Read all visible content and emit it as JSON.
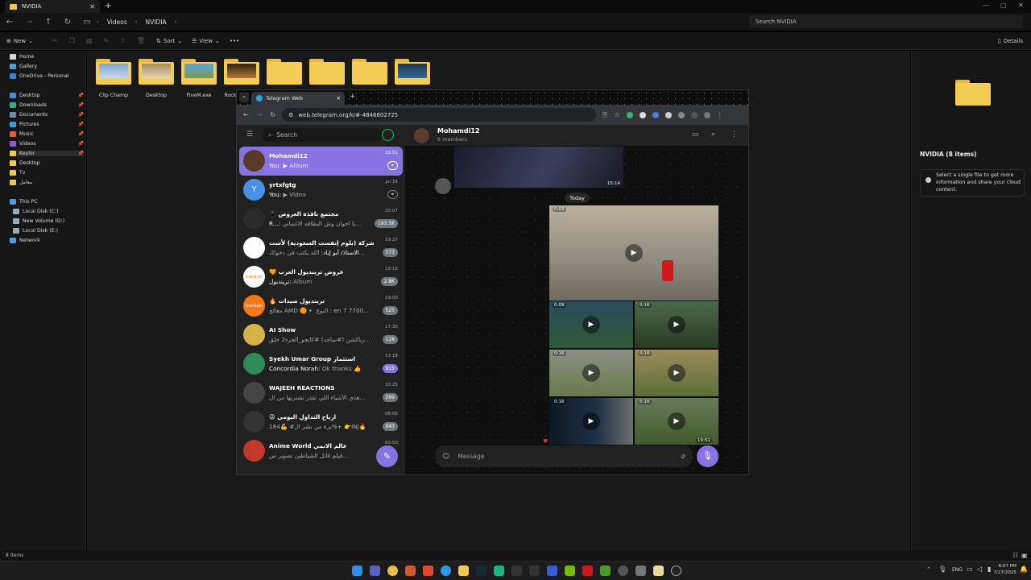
{
  "explorer": {
    "tab_title": "NVIDIA",
    "breadcrumb": [
      "Videos",
      "NVIDIA"
    ],
    "search_placeholder": "Search NVIDIA",
    "toolbar": {
      "new": "New",
      "sort": "Sort",
      "view": "View",
      "more": "•••",
      "details": "Details"
    },
    "sidebar": {
      "quick": [
        "Home",
        "Gallery",
        "OneDrive - Personal"
      ],
      "pinned": [
        "Desktop",
        "Downloads",
        "Documents",
        "Pictures",
        "Music",
        "Videos",
        "Keylor",
        "Desktop",
        "Tv",
        "معامل"
      ],
      "this_pc": "This PC",
      "drives": [
        "Local Disk (C:)",
        "New Volume (D:)",
        "Local Disk (E:)"
      ],
      "network": "Network"
    },
    "folders": [
      "Clip Champ",
      "Desktop",
      "FiveM.exe",
      "Rock"
    ],
    "details_pane": {
      "title": "NVIDIA (8 items)",
      "info": "Select a single file to get more information and share your cloud content."
    },
    "status": "8 items"
  },
  "browser": {
    "tab_title": "Telegram Web",
    "url": "web.telegram.org/k/#-4846602725"
  },
  "telegram": {
    "search_placeholder": "Search",
    "chats": [
      {
        "title": "Mohamdi12",
        "sender": "You:",
        "preview": "▶ Album",
        "time": "19:51",
        "badge": "",
        "avatar_text": "",
        "avatar_color": "#5a3a2a"
      },
      {
        "title": "yrtxfgtg",
        "sender": "You:",
        "preview": "▶ Video",
        "time": "Jul 16",
        "badge": "",
        "avatar_text": "Y",
        "avatar_color": "#4a90e2"
      },
      {
        "title": "📱 مجتمع نافذة العروض",
        "sender": "R...:",
        "preview": "يا احوان وش البطاقه الائتماني...",
        "time": "20:07",
        "badge": "193.5K",
        "avatar_text": "",
        "avatar_color": "#2a2a2a"
      },
      {
        "title": "شركة (بلوم إنفست السعودية) لأست...",
        "sender": "الاستاذ/ أبو إياد:",
        "preview": "الله يكتب في دخولك...",
        "time": "19:27",
        "badge": "573",
        "avatar_text": "",
        "avatar_color": "#ffffff"
      },
      {
        "title": "🧡 عروض ترينديول العرب",
        "sender": "ترينديول:",
        "preview": "Album",
        "time": "19:16",
        "badge": "2.8K",
        "avatar_text": "trendyol",
        "avatar_color": "#ffffff"
      },
      {
        "title": "🔥 ترينديول صيدات",
        "sender": "",
        "preview": "معالج AMD 🟠🔸 النوع : en 7 7700...",
        "time": "19:00",
        "badge": "525",
        "avatar_text": "trendyol",
        "avatar_color": "#f27a1a"
      },
      {
        "title": "AI Show",
        "sender": "",
        "preview": "رياكشن (#ساجد) #كابجو_الجزء2 حلق...",
        "time": "17:36",
        "badge": "128",
        "avatar_text": "",
        "avatar_color": "#d4b44a"
      },
      {
        "title": "Syekh Umar Group استثمار",
        "sender": "Concordia Norah:",
        "preview": "Ok thanks 👍",
        "time": "13:18",
        "badge": "915",
        "avatar_text": "",
        "avatar_color": "#2e8b57"
      },
      {
        "title": "WAJEEH REACTIONS",
        "sender": "",
        "preview": "هذي الأشياء اللي تقدر تشتريها من ال...",
        "time": "10:25",
        "badge": "269",
        "avatar_text": "",
        "avatar_color": "#444"
      },
      {
        "title": "😜 ارباح التداول اليومي",
        "sender": "",
        "preview": "يرة من نشر ال# 💪184%+ 👉INJ🔥",
        "time": "08:06",
        "badge": "843",
        "avatar_text": "",
        "avatar_color": "#333"
      },
      {
        "title": "Anime World عالم الانمي",
        "sender": "",
        "preview": "فيلم قاتل الشياطين تصوير س...",
        "time": "00:50",
        "badge": "",
        "avatar_text": "",
        "avatar_color": "#c0392b"
      }
    ],
    "conversation": {
      "title": "Mohamdi12",
      "subtitle": "6 members",
      "date_label": "Today",
      "top_media_time": "15:14",
      "album_time": "19:51",
      "durations": [
        "0:03",
        "0:09",
        "0:16",
        "0:16",
        "0:16",
        "0:16",
        "0:16"
      ],
      "input_placeholder": "Message"
    }
  },
  "taskbar": {
    "lang": "ENG",
    "time": "8:07 PM",
    "date": "7/27/2025"
  }
}
